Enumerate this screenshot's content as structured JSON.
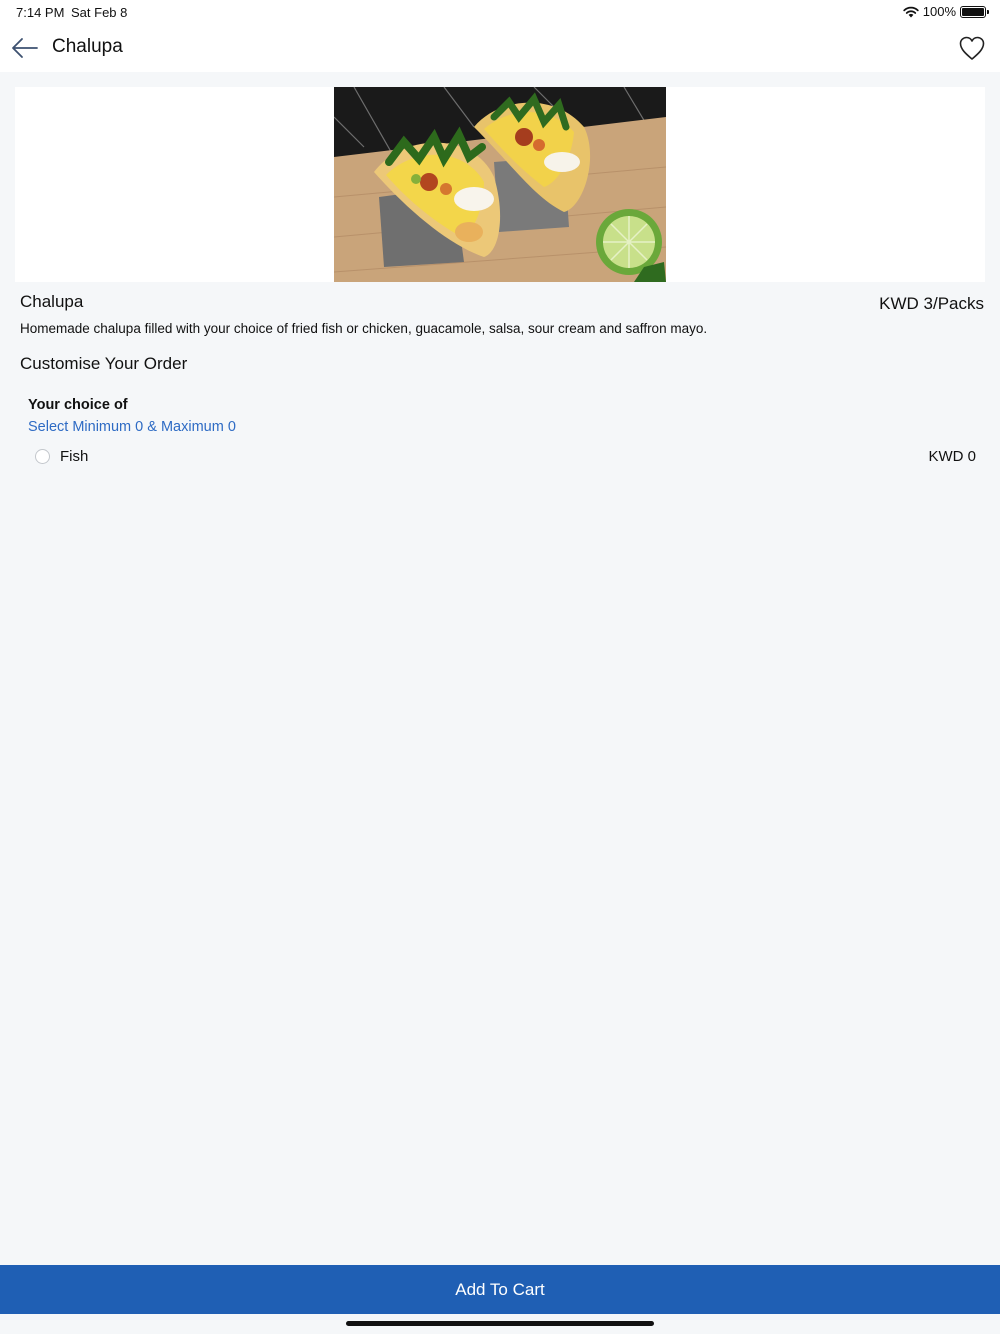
{
  "status_bar": {
    "time": "7:14 PM",
    "date": "Sat Feb 8",
    "battery": "100%",
    "icons": [
      "wifi-icon",
      "battery-icon"
    ]
  },
  "header": {
    "title": "Chalupa",
    "back_icon": "back-arrow-icon",
    "favorite_icon": "heart-icon"
  },
  "product": {
    "image_alt": "Chalupa",
    "name": "Chalupa",
    "price": "KWD 3/Packs",
    "description": "Homemade chalupa filled with your choice of fried fish or chicken, guacamole, salsa, sour cream and saffron mayo."
  },
  "customise": {
    "section_title": "Customise Your Order",
    "groups": [
      {
        "title": "Your choice of",
        "rule": "Select Minimum 0 & Maximum 0",
        "options": [
          {
            "label": "Fish",
            "price": "KWD 0",
            "selected": false
          }
        ]
      }
    ]
  },
  "footer": {
    "cta_label": "Add To Cart"
  },
  "colors": {
    "accent": "#1f5fb4",
    "link": "#2e6bc4",
    "background": "#f5f7f9"
  }
}
